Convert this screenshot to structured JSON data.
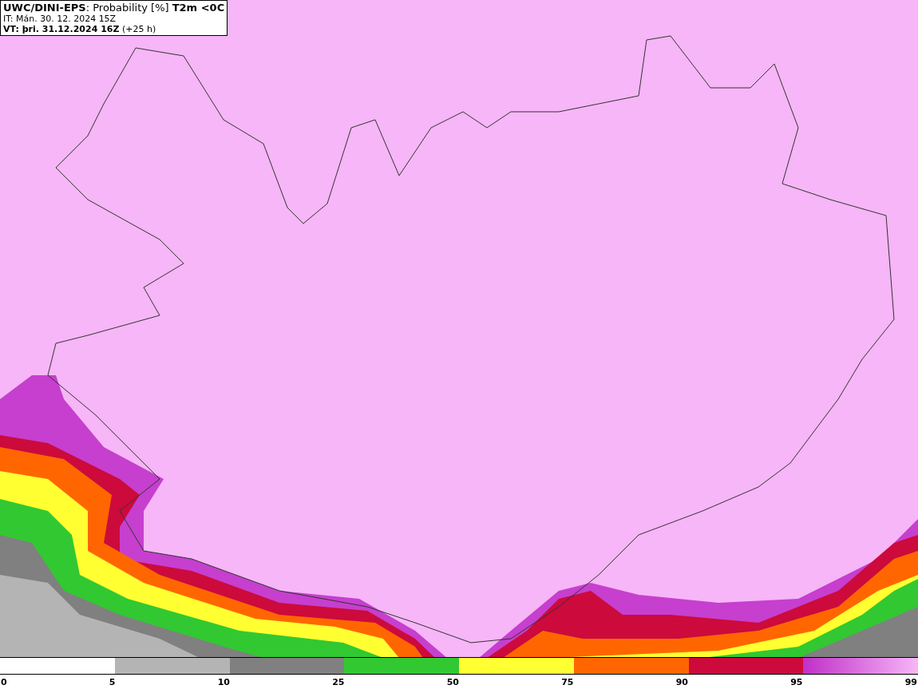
{
  "header": {
    "lines": [
      "**UWC/DINI-EPS**: Probability [%] **T2m <0C**",
      "IT: Mán. 30. 12. 2024 15Z",
      "**VT: þri. 31.12.2024 16Z** (+25 h)"
    ]
  },
  "legend": {
    "segments": [
      {
        "kind": "blank"
      },
      {
        "kind": "solid",
        "color": "#b4b4b4"
      },
      {
        "kind": "solid",
        "color": "#808080"
      },
      {
        "kind": "solid",
        "color": "#32c832"
      },
      {
        "kind": "solid",
        "color": "#ffff32"
      },
      {
        "kind": "solid",
        "color": "#ff6600"
      },
      {
        "kind": "solid",
        "color": "#cc0a3c"
      },
      {
        "kind": "gradient"
      }
    ],
    "labels": [
      "0",
      "5",
      "10",
      "25",
      "50",
      "75",
      "90",
      "95",
      "99"
    ]
  }
}
